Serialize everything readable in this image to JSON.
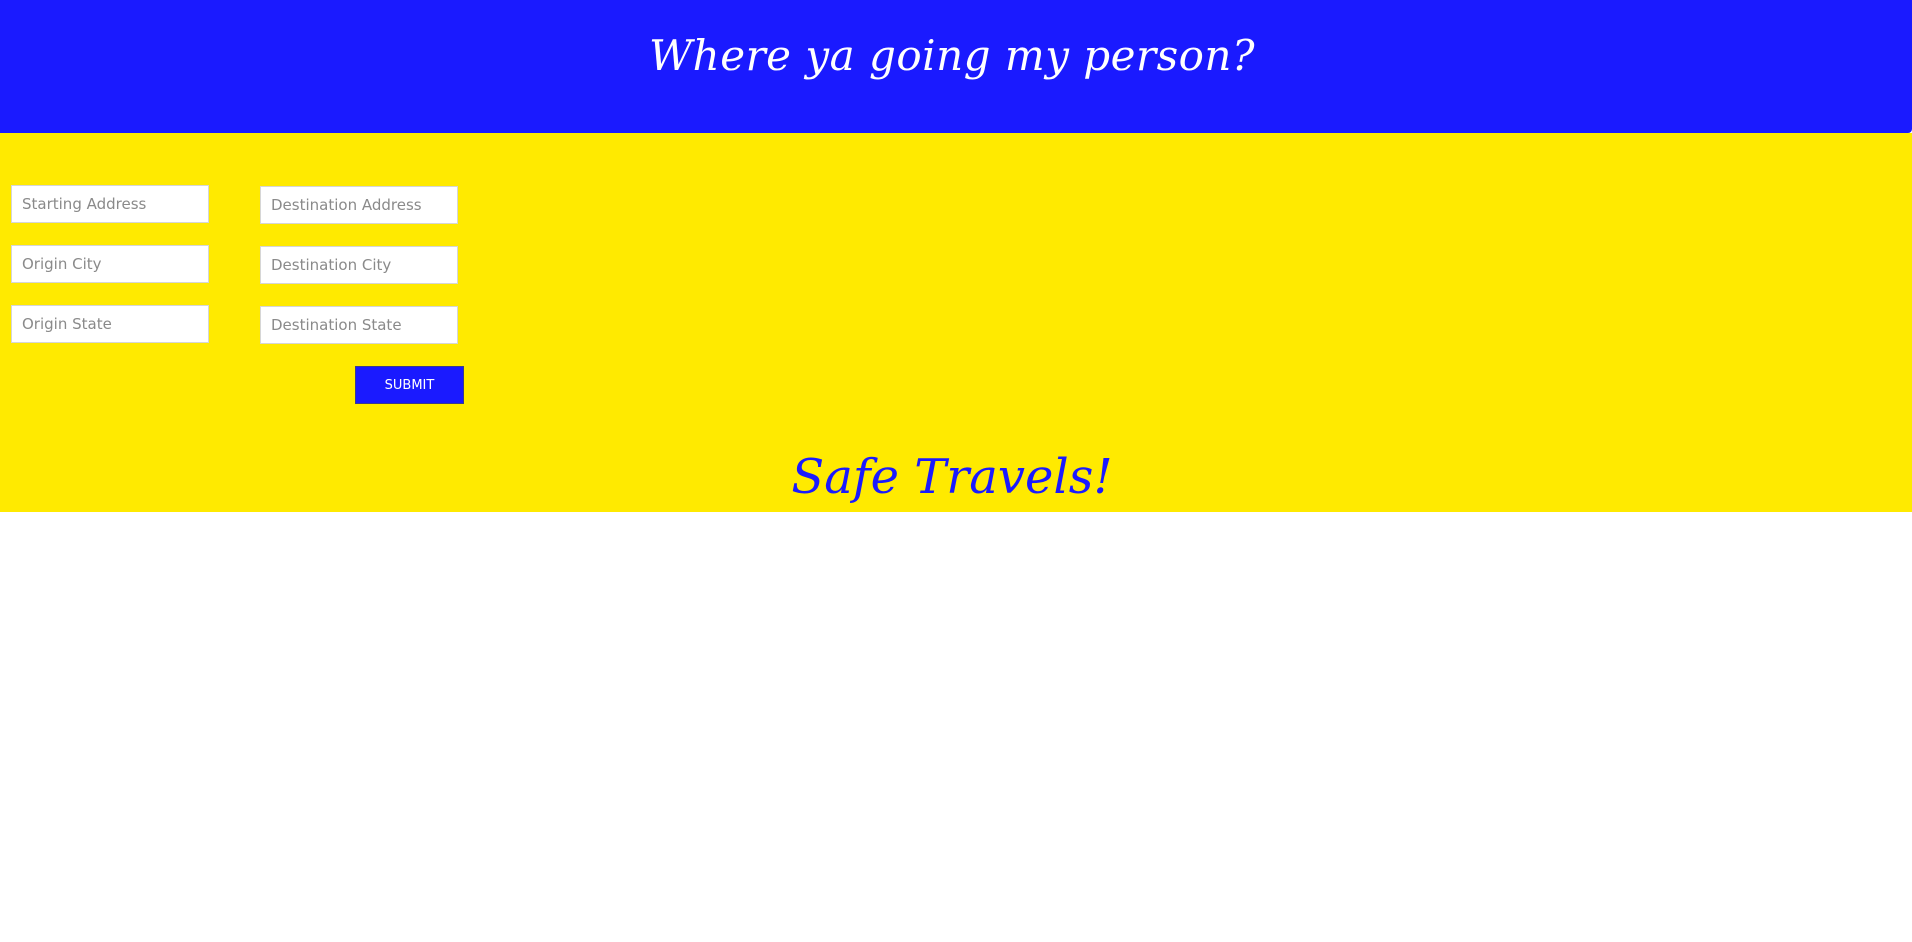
{
  "header": {
    "title": "Where ya going my person?"
  },
  "form": {
    "origin": {
      "address_placeholder": "Starting Address",
      "address_value": "",
      "city_placeholder": "Origin City",
      "city_value": "",
      "state_placeholder": "Origin State",
      "state_value": ""
    },
    "destination": {
      "address_placeholder": "Destination Address",
      "address_value": "",
      "city_placeholder": "Destination City",
      "city_value": "",
      "state_placeholder": "Destination State",
      "state_value": ""
    },
    "submit_label": "SUBMIT"
  },
  "footer": {
    "message": "Safe Travels!"
  },
  "colors": {
    "header_background": "#1a1aff",
    "form_background": "#ffea00",
    "accent": "#1a1aff",
    "page_background": "#ffffff"
  }
}
